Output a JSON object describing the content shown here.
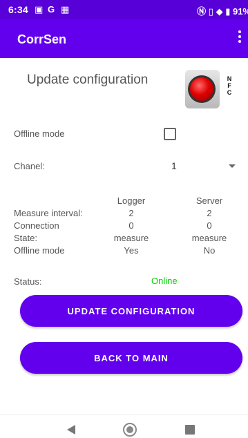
{
  "status_bar": {
    "time": "6:34",
    "battery": "91%"
  },
  "app_bar": {
    "title": "CorrSen"
  },
  "header": {
    "title": "Update configuration"
  },
  "nfc": {
    "letters": [
      "N",
      "F",
      "C"
    ]
  },
  "offline_mode": {
    "label": "Offline mode",
    "checked": false
  },
  "chanel": {
    "label": "Chanel:",
    "value": "1"
  },
  "config_table": {
    "headers": [
      "",
      "Logger",
      "Server"
    ],
    "rows": [
      {
        "label": "Measure interval:",
        "logger": "2",
        "server": "2"
      },
      {
        "label": "Connection",
        "logger": "0",
        "server": "0"
      },
      {
        "label": "State:",
        "logger": "measure",
        "server": "measure"
      },
      {
        "label": "Offline mode",
        "logger": "Yes",
        "server": "No"
      }
    ]
  },
  "status": {
    "label": "Status:",
    "value": "Online",
    "color": "#00d400"
  },
  "buttons": {
    "update": "UPDATE CONFIGURATION",
    "back": "BACK TO MAIN"
  },
  "colors": {
    "primary": "#6200ee",
    "status_bar": "#5800d8"
  }
}
